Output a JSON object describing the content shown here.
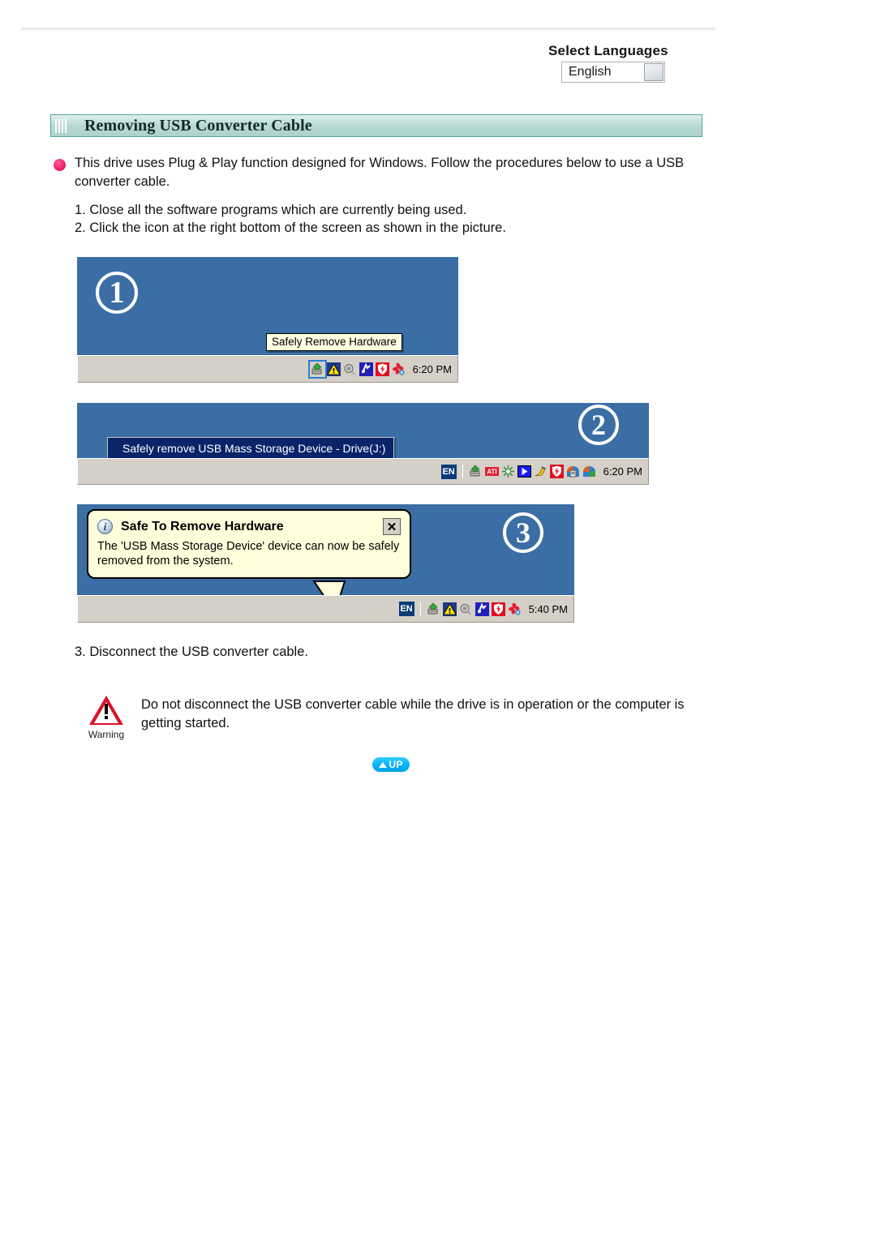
{
  "language_selector": {
    "title": "Select Languages",
    "selected": "English",
    "dropdown_icon": "dropdown-arrow-icon"
  },
  "section": {
    "icon": "bars-icon",
    "title": "Removing USB Converter Cable"
  },
  "intro": {
    "bullet_icon": "bullet-dot-icon",
    "text": "This drive uses Plug & Play function designed for Windows. Follow the procedures below to use a USB converter cable."
  },
  "steps": [
    "1. Close all the software programs which are currently being used.",
    "2. Click the icon at the right bottom of the screen as shown in the picture.",
    "3. Disconnect the USB converter cable."
  ],
  "figures": [
    {
      "badge": "1",
      "tooltip": "Safely Remove Hardware",
      "clock": "6:20 PM",
      "tray_icons": [
        "safely-remove-hardware-icon",
        "warning-icon",
        "sound-volume-icon",
        "network-connection-icon",
        "antivirus-shield-icon",
        "bluetooth-flower-icon"
      ]
    },
    {
      "badge": "2",
      "menu_item": "Safely remove USB Mass Storage Device - Drive(J:)",
      "clock": "6:20 PM",
      "language_indicator": "EN",
      "tray_icons": [
        "safely-remove-hardware-icon",
        "ati-catalyst-icon",
        "gear-settings-icon",
        "media-play-icon",
        "paint-brush-icon",
        "antivirus-shield-icon",
        "printer-icon",
        "windows-update-icon"
      ]
    },
    {
      "badge": "3",
      "balloon_icon": "info-icon",
      "balloon_title": "Safe To Remove Hardware",
      "balloon_close": "✕",
      "balloon_body": "The 'USB Mass Storage Device' device can now be safely removed from the system.",
      "clock": "5:40 PM",
      "language_indicator": "EN",
      "tray_icons": [
        "safely-remove-hardware-icon",
        "warning-icon",
        "sound-volume-icon",
        "network-connection-icon",
        "antivirus-shield-icon",
        "bluetooth-flower-icon"
      ]
    }
  ],
  "warning": {
    "icon": "warning-triangle-icon",
    "label": "Warning",
    "text": "Do not disconnect the USB converter cable while the drive is in operation or the computer is getting started."
  },
  "up_button": {
    "icon": "up-triangle-icon",
    "label": "UP"
  },
  "colors": {
    "desktop_blue": "#3b6ea5",
    "taskbar_gray": "#d4d0c8",
    "section_teal": "#a9d2cd",
    "bullet_pink": "#f0226f",
    "up_cyan": "#00a2e8",
    "warning_red": "#d81327",
    "menu_blue": "#0a246a",
    "balloon_yellow": "#ffffdc"
  }
}
